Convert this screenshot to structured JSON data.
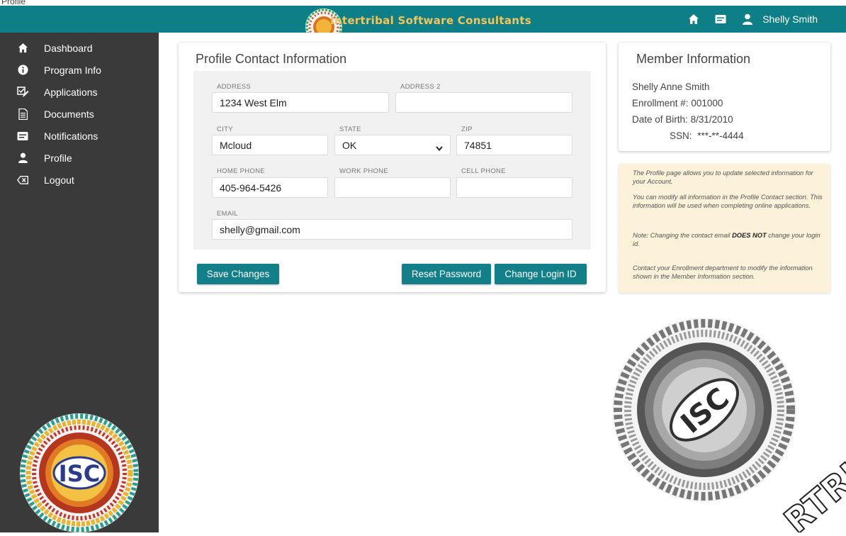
{
  "page_tab": "Profile",
  "header": {
    "brand": "Intertribal Software Consultants",
    "user_name": "Shelly Smith",
    "icons": [
      "home-icon",
      "message-icon",
      "user-icon"
    ],
    "color": "#0e7f86",
    "brand_color": "#f4c55d"
  },
  "sidebar": {
    "items": [
      {
        "label": "Dashboard",
        "icon": "home-icon"
      },
      {
        "label": "Program Info",
        "icon": "info-icon"
      },
      {
        "label": "Applications",
        "icon": "edit-checklist-icon"
      },
      {
        "label": "Documents",
        "icon": "document-icon"
      },
      {
        "label": "Notifications",
        "icon": "message-icon"
      },
      {
        "label": "Profile",
        "icon": "user-icon"
      },
      {
        "label": "Logout",
        "icon": "backspace-icon"
      }
    ],
    "logo_text": "ISC"
  },
  "contact": {
    "title": "Profile Contact Information",
    "address_label": "ADDRESS",
    "address_value": "1234 West Elm",
    "address2_label": "ADDRESS 2",
    "address2_value": "",
    "city_label": "CITY",
    "city_value": "Mcloud",
    "state_label": "STATE",
    "state_value": "OK",
    "zip_label": "ZIP",
    "zip_value": "74851",
    "home_phone_label": "HOME PHONE",
    "home_phone_value": "405-964-5426",
    "work_phone_label": "WORK PHONE",
    "work_phone_value": "",
    "cell_phone_label": "CELL PHONE",
    "cell_phone_value": "",
    "email_label": "EMAIL",
    "email_value": "shelly@gmail.com",
    "save_button": "Save Changes",
    "reset_button": "Reset Password",
    "change_login_button": "Change Login ID"
  },
  "member": {
    "title": "Member Information",
    "name": "Shelly Anne Smith",
    "enrollment_label": "Enrollment #:",
    "enrollment_value": "001000",
    "dob_label": "Date of Birth:",
    "dob_value": "8/31/2010",
    "ssn_label": "SSN:",
    "ssn_value": "***-**-4444"
  },
  "help": {
    "p1": "The Profile page allows you to update selected information for your Account.",
    "p2": "You can modify all information in the Profile Contact section. This information will be used when completing online applications.",
    "p3_a": "Note: Changing the contact email ",
    "p3_b": "DOES NOT",
    "p3_c": " change your login id.",
    "p4": "Contact your Enrollment department to modify the information shown in the Member Information section."
  },
  "watermark": {
    "logo_text": "ISC",
    "partial_text": "RTRI ON"
  }
}
